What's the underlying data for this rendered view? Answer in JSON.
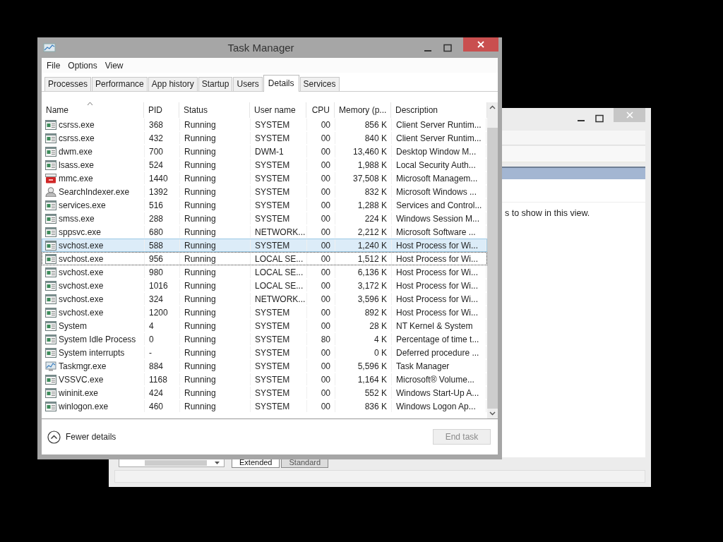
{
  "window": {
    "title": "Task Manager"
  },
  "menu": [
    "File",
    "Options",
    "View"
  ],
  "tabs": [
    {
      "label": "Processes",
      "selected": false
    },
    {
      "label": "Performance",
      "selected": false
    },
    {
      "label": "App history",
      "selected": false
    },
    {
      "label": "Startup",
      "selected": false
    },
    {
      "label": "Users",
      "selected": false
    },
    {
      "label": "Details",
      "selected": true
    },
    {
      "label": "Services",
      "selected": false
    }
  ],
  "columns": [
    {
      "label": "Name",
      "sorted": true
    },
    {
      "label": "PID",
      "sorted": false
    },
    {
      "label": "Status",
      "sorted": false
    },
    {
      "label": "User name",
      "sorted": false
    },
    {
      "label": "CPU",
      "sorted": false
    },
    {
      "label": "Memory (p...",
      "sorted": false
    },
    {
      "label": "Description",
      "sorted": false
    }
  ],
  "rows": [
    {
      "kind": "app",
      "cells": [
        "csrss.exe",
        "368",
        "Running",
        "SYSTEM",
        "00",
        "856 K",
        "Client Server Runtim..."
      ],
      "selected": false,
      "focused": false
    },
    {
      "kind": "app",
      "cells": [
        "csrss.exe",
        "432",
        "Running",
        "SYSTEM",
        "00",
        "840 K",
        "Client Server Runtim..."
      ],
      "selected": false,
      "focused": false
    },
    {
      "kind": "app",
      "cells": [
        "dwm.exe",
        "700",
        "Running",
        "DWM-1",
        "00",
        "13,460 K",
        "Desktop Window M..."
      ],
      "selected": false,
      "focused": false
    },
    {
      "kind": "app",
      "cells": [
        "lsass.exe",
        "524",
        "Running",
        "SYSTEM",
        "00",
        "1,988 K",
        "Local Security Auth..."
      ],
      "selected": false,
      "focused": false
    },
    {
      "kind": "toolbox",
      "cells": [
        "mmc.exe",
        "1440",
        "Running",
        "SYSTEM",
        "00",
        "37,508 K",
        "Microsoft Managem..."
      ],
      "selected": false,
      "focused": false
    },
    {
      "kind": "person",
      "cells": [
        "SearchIndexer.exe",
        "1392",
        "Running",
        "SYSTEM",
        "00",
        "832 K",
        "Microsoft Windows ..."
      ],
      "selected": false,
      "focused": false
    },
    {
      "kind": "app",
      "cells": [
        "services.exe",
        "516",
        "Running",
        "SYSTEM",
        "00",
        "1,288 K",
        "Services and Control..."
      ],
      "selected": false,
      "focused": false
    },
    {
      "kind": "app",
      "cells": [
        "smss.exe",
        "288",
        "Running",
        "SYSTEM",
        "00",
        "224 K",
        "Windows Session M..."
      ],
      "selected": false,
      "focused": false
    },
    {
      "kind": "app",
      "cells": [
        "sppsvc.exe",
        "680",
        "Running",
        "NETWORK...",
        "00",
        "2,212 K",
        "Microsoft Software ..."
      ],
      "selected": false,
      "focused": false
    },
    {
      "kind": "app",
      "cells": [
        "svchost.exe",
        "588",
        "Running",
        "SYSTEM",
        "00",
        "1,240 K",
        "Host Process for Wi..."
      ],
      "selected": true,
      "focused": false
    },
    {
      "kind": "app",
      "cells": [
        "svchost.exe",
        "956",
        "Running",
        "LOCAL SE...",
        "00",
        "1,512 K",
        "Host Process for Wi..."
      ],
      "selected": false,
      "focused": true
    },
    {
      "kind": "app",
      "cells": [
        "svchost.exe",
        "980",
        "Running",
        "LOCAL SE...",
        "00",
        "6,136 K",
        "Host Process for Wi..."
      ],
      "selected": false,
      "focused": false
    },
    {
      "kind": "app",
      "cells": [
        "svchost.exe",
        "1016",
        "Running",
        "LOCAL SE...",
        "00",
        "3,172 K",
        "Host Process for Wi..."
      ],
      "selected": false,
      "focused": false
    },
    {
      "kind": "app",
      "cells": [
        "svchost.exe",
        "324",
        "Running",
        "NETWORK...",
        "00",
        "3,596 K",
        "Host Process for Wi..."
      ],
      "selected": false,
      "focused": false
    },
    {
      "kind": "app",
      "cells": [
        "svchost.exe",
        "1200",
        "Running",
        "SYSTEM",
        "00",
        "892 K",
        "Host Process for Wi..."
      ],
      "selected": false,
      "focused": false
    },
    {
      "kind": "app",
      "cells": [
        "System",
        "4",
        "Running",
        "SYSTEM",
        "00",
        "28 K",
        "NT Kernel & System"
      ],
      "selected": false,
      "focused": false
    },
    {
      "kind": "app",
      "cells": [
        "System Idle Process",
        "0",
        "Running",
        "SYSTEM",
        "80",
        "4 K",
        "Percentage of time t..."
      ],
      "selected": false,
      "focused": false
    },
    {
      "kind": "app",
      "cells": [
        "System interrupts",
        "-",
        "Running",
        "SYSTEM",
        "00",
        "0 K",
        "Deferred procedure ..."
      ],
      "selected": false,
      "focused": false
    },
    {
      "kind": "chart",
      "cells": [
        "Taskmgr.exe",
        "884",
        "Running",
        "SYSTEM",
        "00",
        "5,596 K",
        "Task Manager"
      ],
      "selected": false,
      "focused": false
    },
    {
      "kind": "app",
      "cells": [
        "VSSVC.exe",
        "1168",
        "Running",
        "SYSTEM",
        "00",
        "1,164 K",
        "Microsoft® Volume..."
      ],
      "selected": false,
      "focused": false
    },
    {
      "kind": "app",
      "cells": [
        "wininit.exe",
        "424",
        "Running",
        "SYSTEM",
        "00",
        "552 K",
        "Windows Start-Up A..."
      ],
      "selected": false,
      "focused": false
    },
    {
      "kind": "app",
      "cells": [
        "winlogon.exe",
        "460",
        "Running",
        "SYSTEM",
        "00",
        "836 K",
        "Windows Logon Ap..."
      ],
      "selected": false,
      "focused": false
    }
  ],
  "fewer_details": "Fewer details",
  "end_task": {
    "label": "End task",
    "disabled": true
  },
  "background_window": {
    "message": "s to show in this view.",
    "tabs": [
      {
        "label": "Extended",
        "selected": true
      },
      {
        "label": "Standard",
        "selected": false
      }
    ]
  }
}
